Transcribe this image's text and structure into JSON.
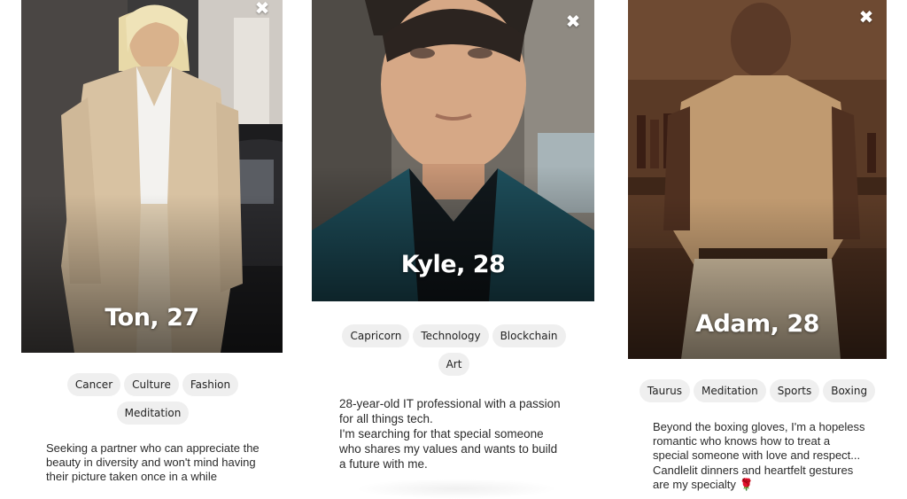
{
  "profiles": [
    {
      "name_age": "Ton, 27",
      "close_symbol": "✖",
      "tags": [
        "Cancer",
        "Culture",
        "Fashion",
        "Meditation"
      ],
      "bio": "Seeking a partner who can appreciate the\nbeauty in diversity and won't mind having\ntheir picture taken once in a while"
    },
    {
      "name_age": "Kyle, 28",
      "close_symbol": "✖",
      "tags": [
        "Capricorn",
        "Technology",
        "Blockchain",
        "Art"
      ],
      "bio": "28-year-old IT professional with a passion\nfor all things tech.\nI'm searching for that special someone\nwho shares my values and wants to build\na future with me."
    },
    {
      "name_age": "Adam, 28",
      "close_symbol": "✖",
      "tags": [
        "Taurus",
        "Meditation",
        "Sports",
        "Boxing"
      ],
      "bio": "Beyond the boxing gloves, I'm a hopeless\nromantic who knows how to treat a\nspecial someone with love and respect...\nCandlelit dinners and heartfelt gestures\nare my specialty 🌹"
    }
  ],
  "colors": {
    "tag_bg": "#efefef",
    "name_text": "#ffffff",
    "bio_text": "#2b2b2b"
  }
}
